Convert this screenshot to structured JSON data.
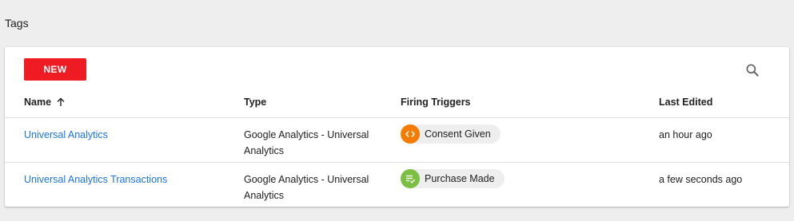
{
  "page": {
    "title": "Tags"
  },
  "toolbar": {
    "new_label": "NEW",
    "search_icon": "search-icon"
  },
  "table": {
    "headers": {
      "name": "Name",
      "type": "Type",
      "triggers": "Firing Triggers",
      "last_edited": "Last Edited"
    },
    "sort_icon": "arrow-up-icon",
    "rows": [
      {
        "name": "Universal Analytics",
        "type": "Google Analytics - Universal Analytics",
        "trigger": {
          "label": "Consent Given",
          "icon": "code-icon",
          "color": "#f57c00"
        },
        "last_edited": "an hour ago"
      },
      {
        "name": "Universal Analytics Transactions",
        "type": "Google Analytics - Universal Analytics",
        "trigger": {
          "label": "Purchase Made",
          "icon": "checklist-icon",
          "color": "#7cc043"
        },
        "last_edited": "a few seconds ago"
      }
    ]
  },
  "colors": {
    "accent": "#ee1b22",
    "link": "#1a73e8"
  }
}
